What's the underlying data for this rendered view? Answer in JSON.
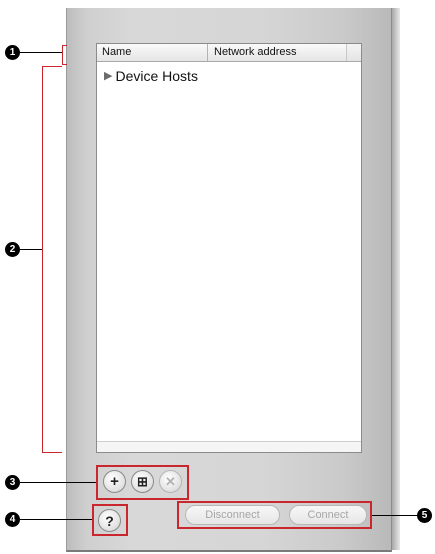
{
  "table": {
    "columns": [
      "Name",
      "Network address"
    ],
    "rows": [
      {
        "label": "Device Hosts",
        "expander": "▶"
      }
    ]
  },
  "toolbar": {
    "add_label": "+",
    "add_folder_label": "⊞",
    "remove_label": "✕",
    "help_label": "?"
  },
  "connection": {
    "disconnect_label": "Disconnect",
    "connect_label": "Connect"
  },
  "callouts": [
    "1",
    "2",
    "3",
    "4",
    "5"
  ],
  "colors": {
    "callout_red": "#c9272d",
    "callout_black": "#000000"
  },
  "icons": {
    "expander": "disclosure-triangle-icon",
    "add": "plus-icon",
    "add_folder": "add-folder-icon",
    "remove": "close-icon",
    "help": "help-icon"
  }
}
